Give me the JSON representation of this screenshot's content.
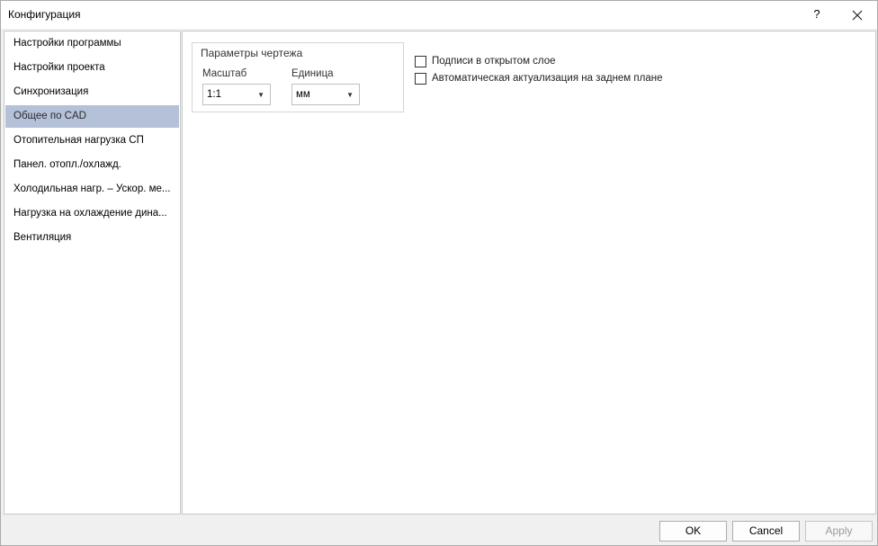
{
  "window": {
    "title": "Конфигурация",
    "help_label": "?"
  },
  "sidebar": {
    "items": [
      {
        "label": "Настройки программы"
      },
      {
        "label": "Настройки проекта"
      },
      {
        "label": "Синхронизация"
      },
      {
        "label": "Общее по CAD",
        "selected": true
      },
      {
        "label": "Отопительная нагрузка СП"
      },
      {
        "label": "Панел. отопл./охлажд."
      },
      {
        "label": "Холодильная нагр. – Ускор. ме..."
      },
      {
        "label": "Нагрузка на охлаждение дина..."
      },
      {
        "label": "Вентиляция"
      }
    ]
  },
  "drawing_params": {
    "title": "Параметры чертежа",
    "scale_label": "Масштаб",
    "scale_value": "1:1",
    "unit_label": "Единица",
    "unit_value": "мм"
  },
  "options": {
    "labels_open_layer": "Подписи в открытом слое",
    "labels_open_layer_checked": false,
    "auto_update_background": "Автоматическая актуализация на заднем плане",
    "auto_update_background_checked": false
  },
  "footer": {
    "ok_label": "OK",
    "cancel_label": "Cancel",
    "apply_label": "Apply",
    "apply_enabled": false
  },
  "colors": {
    "selected_item_bg": "#b4c1d9",
    "window_bg": "#f0f0f0"
  }
}
